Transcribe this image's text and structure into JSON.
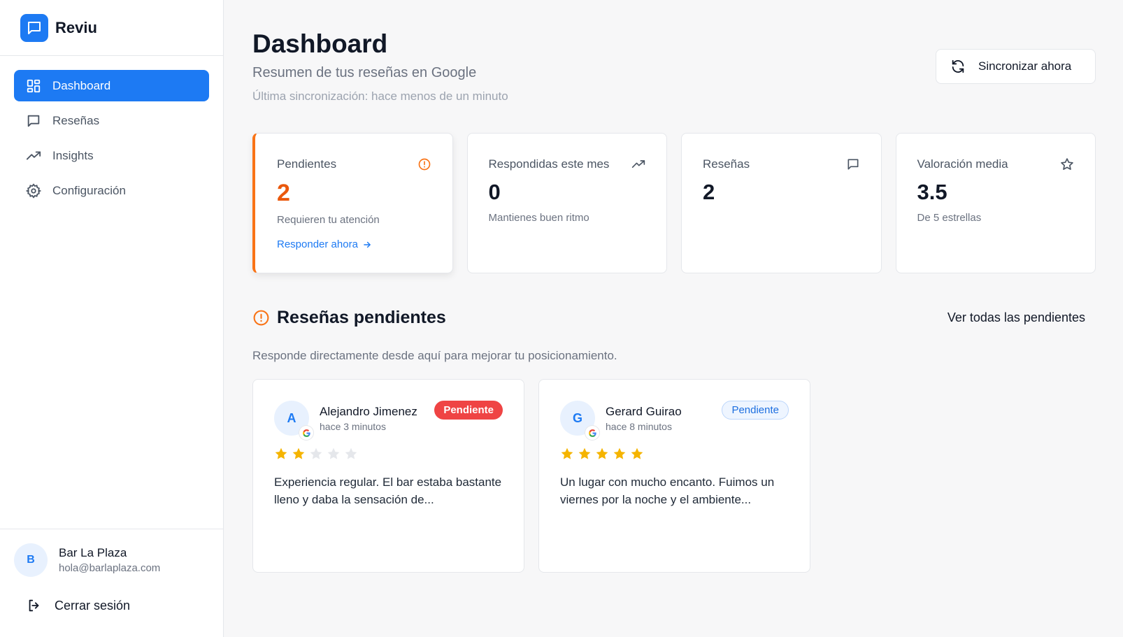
{
  "brand": {
    "name": "Reviu",
    "accent": "#1d7af3"
  },
  "sidebar": {
    "items": [
      {
        "label": "Dashboard",
        "icon": "dashboard-icon",
        "active": true
      },
      {
        "label": "Reseñas",
        "icon": "message-icon",
        "active": false
      },
      {
        "label": "Insights",
        "icon": "trending-up-icon",
        "active": false
      },
      {
        "label": "Configuración",
        "icon": "gear-icon",
        "active": false
      }
    ],
    "account": {
      "initial": "B",
      "name": "Bar La Plaza",
      "email": "hola@barlaplaza.com"
    },
    "logout_label": "Cerrar sesión"
  },
  "header": {
    "title": "Dashboard",
    "subtitle": "Resumen de tus reseñas en Google",
    "last_sync": "Última sincronización: hace menos de un minuto",
    "sync_button": "Sincronizar ahora"
  },
  "stats": [
    {
      "label": "Pendientes",
      "value": "2",
      "desc": "Requieren tu atención",
      "link": "Responder ahora",
      "icon": "alert-circle-icon"
    },
    {
      "label": "Respondidas este mes",
      "value": "0",
      "desc": "Mantienes buen ritmo",
      "icon": "trending-up-icon"
    },
    {
      "label": "Reseñas",
      "value": "2",
      "desc": "",
      "icon": "message-icon"
    },
    {
      "label": "Valoración media",
      "value": "3.5",
      "desc": "De 5 estrellas",
      "icon": "star-icon"
    }
  ],
  "pending": {
    "title": "Reseñas pendientes",
    "view_all": "Ver todas las pendientes",
    "description": "Responde directamente desde aquí para mejorar tu posicionamiento.",
    "reviews": [
      {
        "initial": "A",
        "name": "Alejandro Jimenez",
        "time": "hace 3 minutos",
        "badge": "Pendiente",
        "badge_style": "solid",
        "rating": 2,
        "text": "Experiencia regular. El bar estaba bastante lleno y daba la sensación de..."
      },
      {
        "initial": "G",
        "name": "Gerard Guirao",
        "time": "hace 8 minutos",
        "badge": "Pendiente",
        "badge_style": "outline",
        "rating": 5,
        "text": "Un lugar con mucho encanto. Fuimos un viernes por la noche y el ambiente..."
      }
    ]
  },
  "colors": {
    "warning": "#f97316",
    "danger": "#ef4444",
    "star": "#f5b400",
    "star_empty": "#e5e7eb"
  }
}
